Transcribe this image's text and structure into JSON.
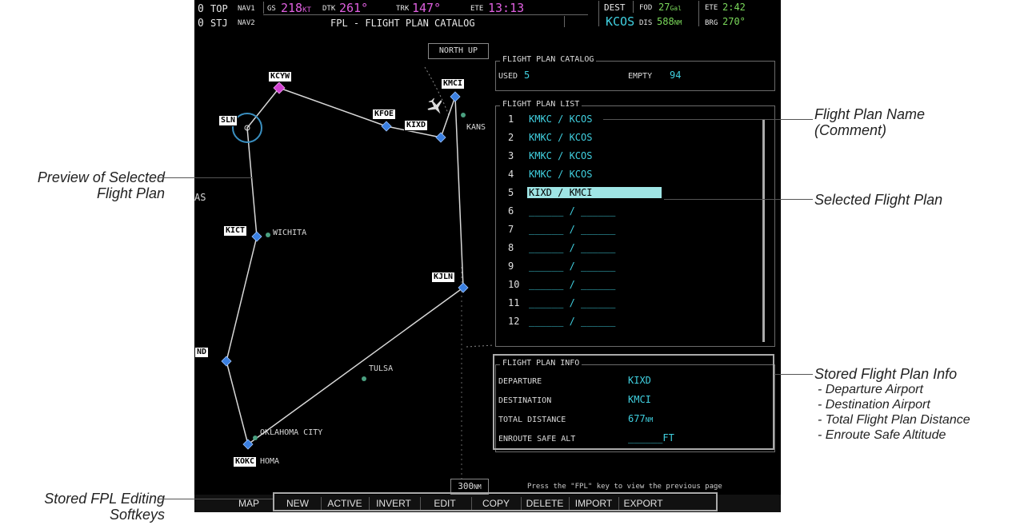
{
  "header": {
    "left_wpt1": "0",
    "left_wpt1_name": "TOP",
    "nav1_label": "NAV1",
    "left_wpt2": "0",
    "left_wpt2_name": "STJ",
    "nav2_label": "NAV2",
    "gs_label": "GS",
    "gs_value": "218",
    "gs_unit": "KT",
    "dtk_label": "DTK",
    "dtk_value": "261°",
    "trk_label": "TRK",
    "trk_value": "147°",
    "ete_label": "ETE",
    "ete_value": "13:13",
    "page_title": "FPL - FLIGHT PLAN CATALOG",
    "dest_label": "DEST",
    "dest_value": "KCOS",
    "fod_label": "FOD",
    "fod_value": "27",
    "fod_unit": "Gal",
    "dis_label": "DIS",
    "dis_value": "588",
    "dis_unit": "NM",
    "ete2_label": "ETE",
    "ete2_value": "2:42",
    "brg_label": "BRG",
    "brg_value": "270°"
  },
  "map": {
    "orientation": "NORTH UP",
    "range": "300",
    "range_unit": "NM",
    "waypoints": {
      "kcyw": "KCYW",
      "sln": "SLN",
      "kfoe": "KFOE",
      "kixd": "KIXD",
      "kmci": "KMCI",
      "kict": "KICT",
      "kjln": "KJLN",
      "nd": "ND",
      "kokc": "KOKC"
    },
    "cities": {
      "wichita": "WICHITA",
      "tulsa": "TULSA",
      "okc": "OKLAHOMA CITY",
      "homa": "HOMA",
      "kans": "KANS",
      "as": "AS"
    }
  },
  "catalog": {
    "title": "FLIGHT PLAN CATALOG",
    "used_label": "USED",
    "used_value": "5",
    "empty_label": "EMPTY",
    "empty_value": "94"
  },
  "fpl_list": {
    "title": "FLIGHT PLAN LIST",
    "rows": [
      {
        "num": "1",
        "name": "KMKC / KCOS"
      },
      {
        "num": "2",
        "name": "KMKC / KCOS"
      },
      {
        "num": "3",
        "name": "KMKC / KCOS"
      },
      {
        "num": "4",
        "name": "KMKC / KCOS"
      },
      {
        "num": "5",
        "name": "KIXD / KMCI"
      },
      {
        "num": "6",
        "name": "______ / ______"
      },
      {
        "num": "7",
        "name": "______ / ______"
      },
      {
        "num": "8",
        "name": "______ / ______"
      },
      {
        "num": "9",
        "name": "______ / ______"
      },
      {
        "num": "10",
        "name": "______ / ______"
      },
      {
        "num": "11",
        "name": "______ / ______"
      },
      {
        "num": "12",
        "name": "______ / ______"
      }
    ],
    "selected_index": 4
  },
  "fpl_info": {
    "title": "FLIGHT PLAN INFO",
    "departure_label": "DEPARTURE",
    "departure_value": "KIXD",
    "destination_label": "DESTINATION",
    "destination_value": "KMCI",
    "distance_label": "TOTAL DISTANCE",
    "distance_value": "677",
    "distance_unit": "NM",
    "esa_label": "ENROUTE SAFE ALT",
    "esa_value": "______FT"
  },
  "hint": "Press the \"FPL\" key to view the previous page",
  "softkeys": [
    "MAP",
    "NEW",
    "ACTIVE",
    "INVERT",
    "EDIT",
    "COPY",
    "DELETE",
    "IMPORT",
    "EXPORT"
  ],
  "callouts": {
    "preview_line1": "Preview of Selected",
    "preview_line2": "Flight Plan",
    "name_line1": "Flight Plan Name",
    "name_line2": "(Comment)",
    "selected": "Selected Flight Plan",
    "info_title": "Stored Flight Plan Info",
    "info_dep": "- Departure Airport",
    "info_dest": "- Destination Airport",
    "info_dist": "- Total Flight Plan Distance",
    "info_esa": "- Enroute Safe Altitude",
    "softkeys_line1": "Stored FPL Editing",
    "softkeys_line2": "Softkeys"
  },
  "colors": {
    "cyan": "#40d0e0",
    "magenta": "#e060e0",
    "selection": "#9fe5e5",
    "route": "#d8d8d8",
    "waypoint_diamond": "#3a7fe0"
  }
}
